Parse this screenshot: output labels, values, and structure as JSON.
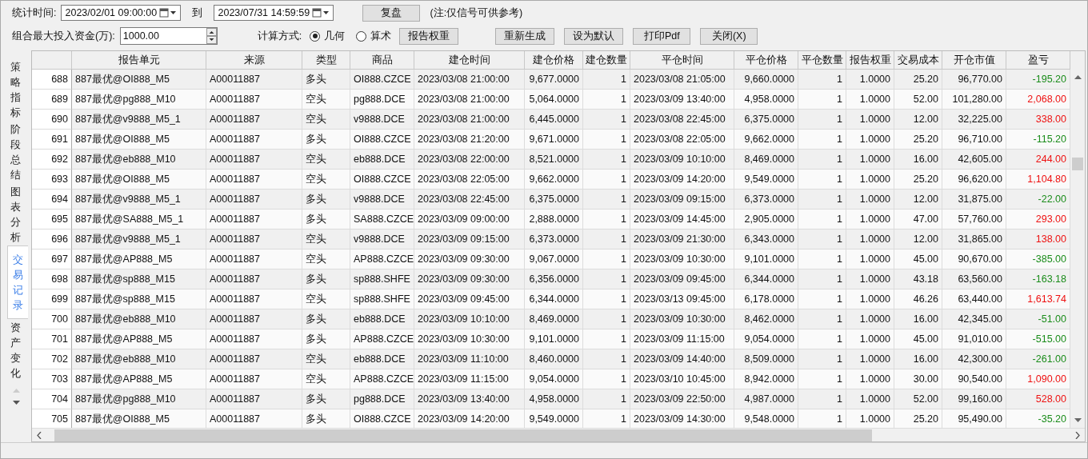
{
  "toolbar": {
    "time_label": "统计时间:",
    "start": "2023/02/01 09:00:00",
    "to_label": "到",
    "end": "2023/07/31 14:59:59",
    "replay_button": "复盘",
    "note": "(注:仅信号可供参考)",
    "capital_label": "组合最大投入资金(万):",
    "capital": "1000.00",
    "method_label": "计算方式:",
    "methods": [
      {
        "label": "几何",
        "selected": true
      },
      {
        "label": "算术",
        "selected": false
      }
    ],
    "weight_button": "报告权重",
    "buttons": [
      "重新生成",
      "设为默认",
      "打印Pdf",
      "关闭(X)"
    ]
  },
  "side_tabs": [
    {
      "label": "策略指标",
      "selected": false
    },
    {
      "label": "阶段总结",
      "selected": false
    },
    {
      "label": "图表分析",
      "selected": false
    },
    {
      "label": "交易记录",
      "selected": true
    },
    {
      "label": "资产变化",
      "selected": false
    }
  ],
  "table": {
    "columns": [
      "",
      "报告单元",
      "来源",
      "类型",
      "商品",
      "建仓时间",
      "建仓价格",
      "建仓数量",
      "平仓时间",
      "平仓价格",
      "平仓数量",
      "报告权重",
      "交易成本",
      "开仓市值",
      "盈亏"
    ],
    "rows": [
      {
        "cells": [
          "688",
          "887最优@OI888_M5",
          "A00011887",
          "多头",
          "OI888.CZCE",
          "2023/03/08 21:00:00",
          "9,677.0000",
          "1",
          "2023/03/08 21:05:00",
          "9,660.0000",
          "1",
          "1.0000",
          "25.20",
          "96,770.00",
          "-195.20"
        ],
        "color": "#1a8c1a"
      },
      {
        "cells": [
          "689",
          "887最优@pg888_M10",
          "A00011887",
          "空头",
          "pg888.DCE",
          "2023/03/08 21:00:00",
          "5,064.0000",
          "1",
          "2023/03/09 13:40:00",
          "4,958.0000",
          "1",
          "1.0000",
          "52.00",
          "101,280.00",
          "2,068.00"
        ],
        "color": "#ee1111"
      },
      {
        "cells": [
          "690",
          "887最优@v9888_M5_1",
          "A00011887",
          "空头",
          "v9888.DCE",
          "2023/03/08 21:00:00",
          "6,445.0000",
          "1",
          "2023/03/08 22:45:00",
          "6,375.0000",
          "1",
          "1.0000",
          "12.00",
          "32,225.00",
          "338.00"
        ],
        "color": "#ee1111"
      },
      {
        "cells": [
          "691",
          "887最优@OI888_M5",
          "A00011887",
          "多头",
          "OI888.CZCE",
          "2023/03/08 21:20:00",
          "9,671.0000",
          "1",
          "2023/03/08 22:05:00",
          "9,662.0000",
          "1",
          "1.0000",
          "25.20",
          "96,710.00",
          "-115.20"
        ],
        "color": "#1a8c1a"
      },
      {
        "cells": [
          "692",
          "887最优@eb888_M10",
          "A00011887",
          "空头",
          "eb888.DCE",
          "2023/03/08 22:00:00",
          "8,521.0000",
          "1",
          "2023/03/09 10:10:00",
          "8,469.0000",
          "1",
          "1.0000",
          "16.00",
          "42,605.00",
          "244.00"
        ],
        "color": "#ee1111"
      },
      {
        "cells": [
          "693",
          "887最优@OI888_M5",
          "A00011887",
          "空头",
          "OI888.CZCE",
          "2023/03/08 22:05:00",
          "9,662.0000",
          "1",
          "2023/03/09 14:20:00",
          "9,549.0000",
          "1",
          "1.0000",
          "25.20",
          "96,620.00",
          "1,104.80"
        ],
        "color": "#ee1111"
      },
      {
        "cells": [
          "694",
          "887最优@v9888_M5_1",
          "A00011887",
          "多头",
          "v9888.DCE",
          "2023/03/08 22:45:00",
          "6,375.0000",
          "1",
          "2023/03/09 09:15:00",
          "6,373.0000",
          "1",
          "1.0000",
          "12.00",
          "31,875.00",
          "-22.00"
        ],
        "color": "#1a8c1a"
      },
      {
        "cells": [
          "695",
          "887最优@SA888_M5_1",
          "A00011887",
          "多头",
          "SA888.CZCE",
          "2023/03/09 09:00:00",
          "2,888.0000",
          "1",
          "2023/03/09 14:45:00",
          "2,905.0000",
          "1",
          "1.0000",
          "47.00",
          "57,760.00",
          "293.00"
        ],
        "color": "#ee1111"
      },
      {
        "cells": [
          "696",
          "887最优@v9888_M5_1",
          "A00011887",
          "空头",
          "v9888.DCE",
          "2023/03/09 09:15:00",
          "6,373.0000",
          "1",
          "2023/03/09 21:30:00",
          "6,343.0000",
          "1",
          "1.0000",
          "12.00",
          "31,865.00",
          "138.00"
        ],
        "color": "#ee1111"
      },
      {
        "cells": [
          "697",
          "887最优@AP888_M5",
          "A00011887",
          "空头",
          "AP888.CZCE",
          "2023/03/09 09:30:00",
          "9,067.0000",
          "1",
          "2023/03/09 10:30:00",
          "9,101.0000",
          "1",
          "1.0000",
          "45.00",
          "90,670.00",
          "-385.00"
        ],
        "color": "#1a8c1a"
      },
      {
        "cells": [
          "698",
          "887最优@sp888_M15",
          "A00011887",
          "多头",
          "sp888.SHFE",
          "2023/03/09 09:30:00",
          "6,356.0000",
          "1",
          "2023/03/09 09:45:00",
          "6,344.0000",
          "1",
          "1.0000",
          "43.18",
          "63,560.00",
          "-163.18"
        ],
        "color": "#1a8c1a"
      },
      {
        "cells": [
          "699",
          "887最优@sp888_M15",
          "A00011887",
          "空头",
          "sp888.SHFE",
          "2023/03/09 09:45:00",
          "6,344.0000",
          "1",
          "2023/03/13 09:45:00",
          "6,178.0000",
          "1",
          "1.0000",
          "46.26",
          "63,440.00",
          "1,613.74"
        ],
        "color": "#ee1111"
      },
      {
        "cells": [
          "700",
          "887最优@eb888_M10",
          "A00011887",
          "多头",
          "eb888.DCE",
          "2023/03/09 10:10:00",
          "8,469.0000",
          "1",
          "2023/03/09 10:30:00",
          "8,462.0000",
          "1",
          "1.0000",
          "16.00",
          "42,345.00",
          "-51.00"
        ],
        "color": "#1a8c1a"
      },
      {
        "cells": [
          "701",
          "887最优@AP888_M5",
          "A00011887",
          "多头",
          "AP888.CZCE",
          "2023/03/09 10:30:00",
          "9,101.0000",
          "1",
          "2023/03/09 11:15:00",
          "9,054.0000",
          "1",
          "1.0000",
          "45.00",
          "91,010.00",
          "-515.00"
        ],
        "color": "#1a8c1a"
      },
      {
        "cells": [
          "702",
          "887最优@eb888_M10",
          "A00011887",
          "空头",
          "eb888.DCE",
          "2023/03/09 11:10:00",
          "8,460.0000",
          "1",
          "2023/03/09 14:40:00",
          "8,509.0000",
          "1",
          "1.0000",
          "16.00",
          "42,300.00",
          "-261.00"
        ],
        "color": "#1a8c1a"
      },
      {
        "cells": [
          "703",
          "887最优@AP888_M5",
          "A00011887",
          "空头",
          "AP888.CZCE",
          "2023/03/09 11:15:00",
          "9,054.0000",
          "1",
          "2023/03/10 10:45:00",
          "8,942.0000",
          "1",
          "1.0000",
          "30.00",
          "90,540.00",
          "1,090.00"
        ],
        "color": "#ee1111"
      },
      {
        "cells": [
          "704",
          "887最优@pg888_M10",
          "A00011887",
          "多头",
          "pg888.DCE",
          "2023/03/09 13:40:00",
          "4,958.0000",
          "1",
          "2023/03/09 22:50:00",
          "4,987.0000",
          "1",
          "1.0000",
          "52.00",
          "99,160.00",
          "528.00"
        ],
        "color": "#ee1111"
      },
      {
        "cells": [
          "705",
          "887最优@OI888_M5",
          "A00011887",
          "多头",
          "OI888.CZCE",
          "2023/03/09 14:20:00",
          "9,549.0000",
          "1",
          "2023/03/09 14:30:00",
          "9,548.0000",
          "1",
          "1.0000",
          "25.20",
          "95,490.00",
          "-35.20"
        ],
        "color": "#1a8c1a"
      }
    ]
  }
}
